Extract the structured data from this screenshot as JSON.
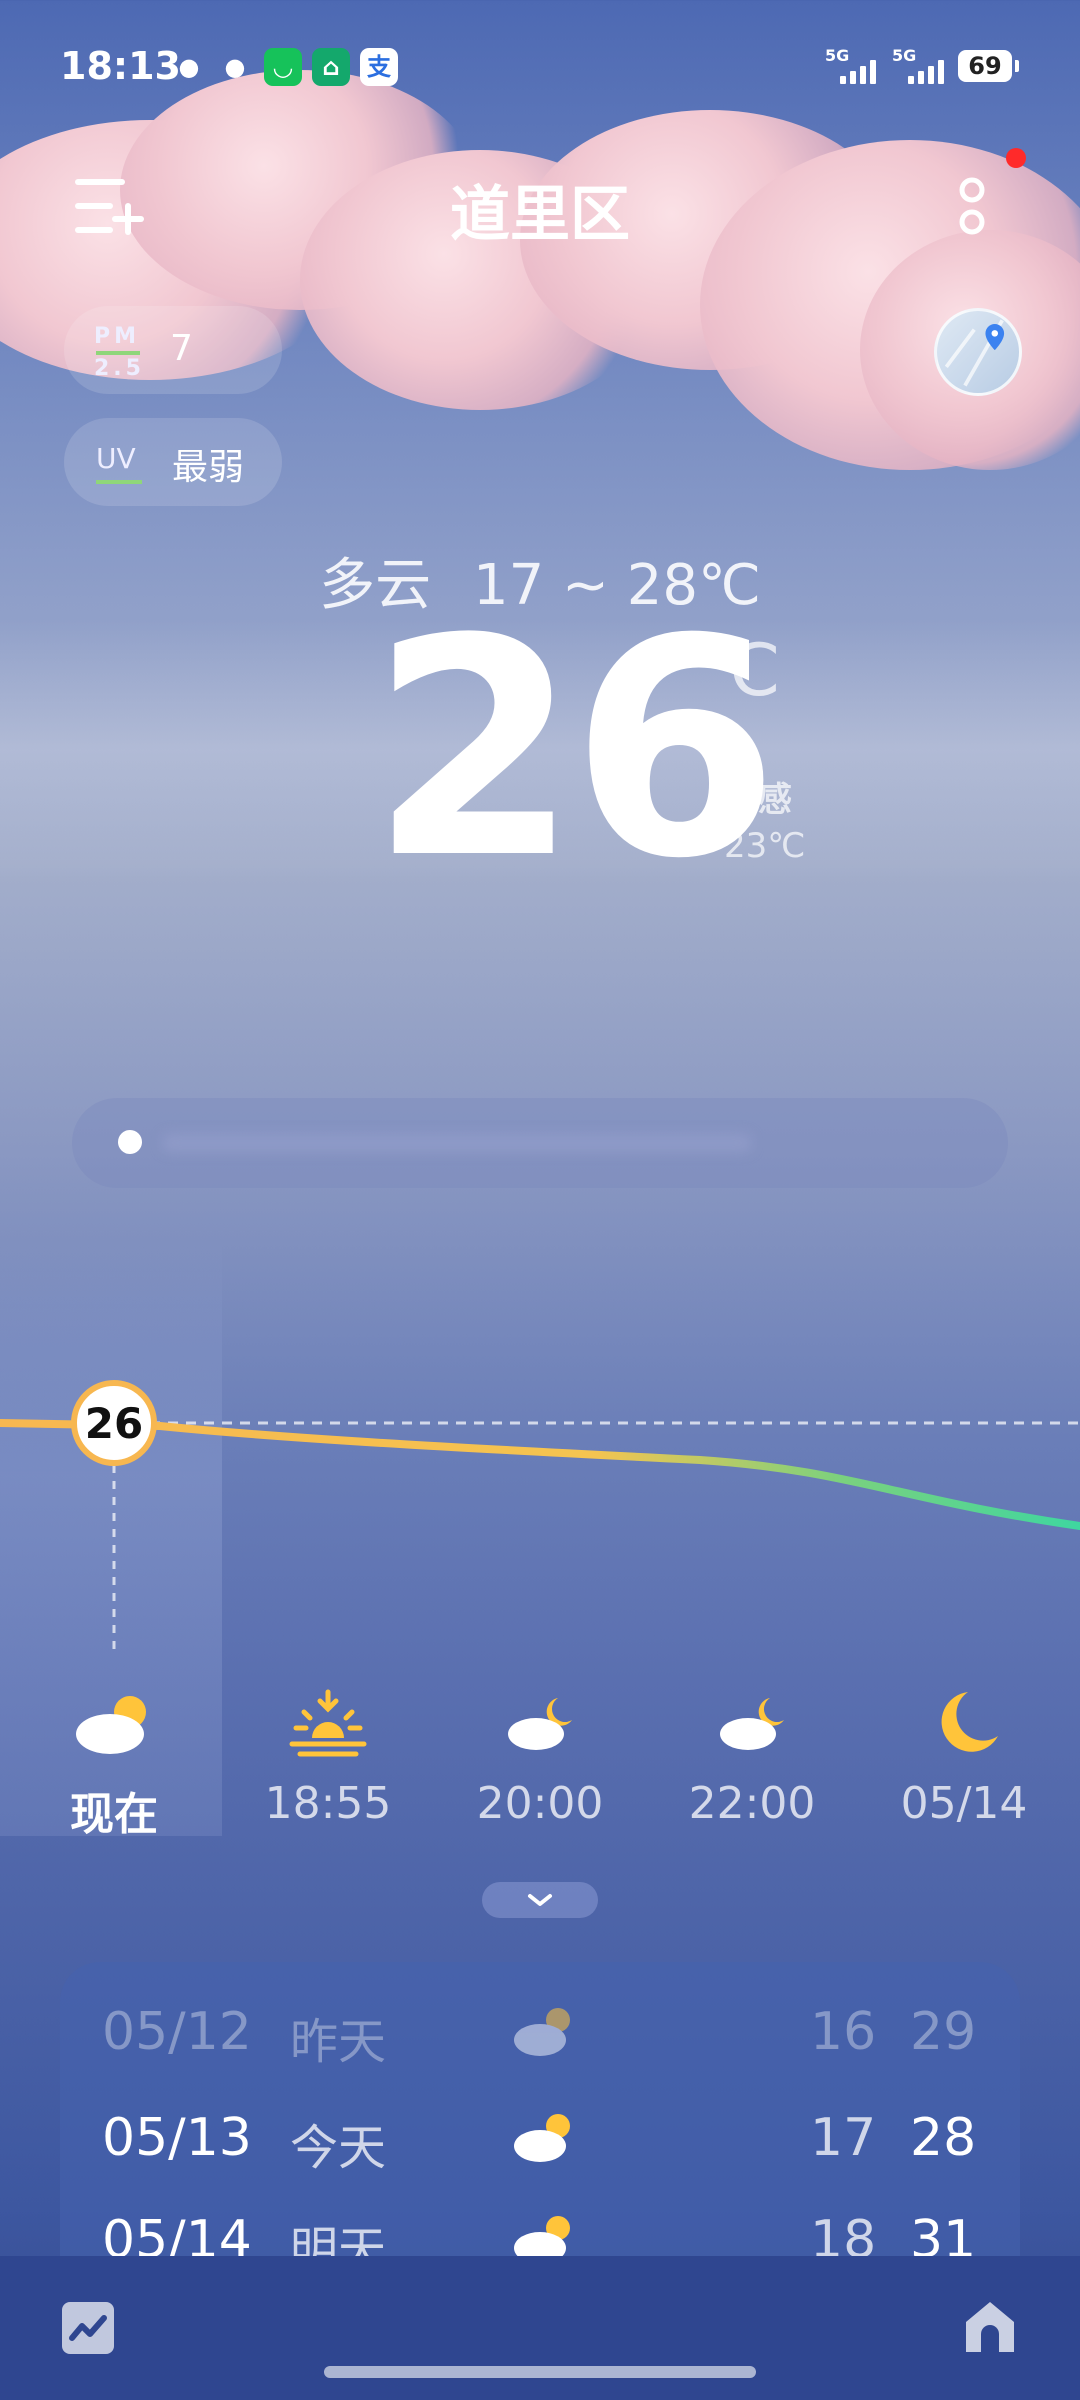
{
  "status_bar": {
    "time": "18:13",
    "signal1_label": "5G",
    "signal2_label": "5G",
    "battery": "69",
    "app_icons": [
      "wechat-icon",
      "wechat-icon",
      "green-app-icon",
      "green-store-icon",
      "alipay-icon"
    ]
  },
  "header": {
    "city": "道里区",
    "menu_icon": "list-add-icon",
    "more_icon": "vertical-dots-icon",
    "notification_dot_color": "#ff2a2a"
  },
  "air": {
    "pm_top": "PM",
    "pm_bottom": "2.5",
    "pm_value": "7",
    "uv_label": "UV",
    "uv_value": "最弱"
  },
  "current": {
    "condition": "多云",
    "range": "17 ~ 28℃",
    "temperature": "26",
    "unit": "℃",
    "feels_label": "体感",
    "feels_value": "23℃"
  },
  "hourly": {
    "now_temp": "26",
    "line_colors": [
      "#f7b750",
      "#7ad17e",
      "#3fd6a0"
    ],
    "items": [
      {
        "label": "现在",
        "icon": "cloudy-day-icon"
      },
      {
        "label": "18:55",
        "icon": "sunset-icon"
      },
      {
        "label": "20:00",
        "icon": "cloudy-night-icon"
      },
      {
        "label": "22:00",
        "icon": "cloudy-night-icon"
      },
      {
        "label": "05/14",
        "icon": "moon-icon"
      }
    ]
  },
  "daily": [
    {
      "date": "05/12",
      "day": "昨天",
      "low": "16",
      "high": "29",
      "icon": "cloudy-day-icon"
    },
    {
      "date": "05/13",
      "day": "今天",
      "low": "17",
      "high": "28",
      "icon": "cloudy-day-icon"
    },
    {
      "date": "05/14",
      "day": "明天",
      "low": "18",
      "high": "31",
      "icon": "cloudy-day-icon"
    }
  ]
}
